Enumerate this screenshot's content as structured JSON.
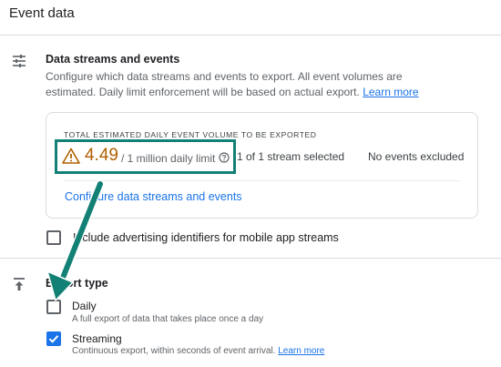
{
  "page": {
    "title": "Event data"
  },
  "data_streams": {
    "title": "Data streams and events",
    "description": "Configure which data streams and events to export. All event volumes are estimated. Daily limit enforcement will be based on actual export.",
    "learn_more": "Learn more",
    "card": {
      "label": "TOTAL ESTIMATED DAILY EVENT VOLUME TO BE EXPORTED",
      "volume_value": "4.49",
      "volume_limit": "/ 1 million daily limit",
      "streams": "1 of 1 stream selected",
      "events": "No events excluded",
      "configure_link": "Configure data streams and events"
    },
    "advertising_checkbox": {
      "label": "Include advertising identifiers for mobile app streams",
      "checked": false
    }
  },
  "export_type": {
    "title": "Export type",
    "options": [
      {
        "title": "Daily",
        "description": "A full export of data that takes place once a day",
        "checked": false
      },
      {
        "title": "Streaming",
        "description": "Continuous export, within seconds of event arrival.",
        "learn_more": "Learn more",
        "checked": true
      }
    ]
  },
  "colors": {
    "accent": "#1a73e8",
    "warning": "#b06000",
    "highlight_annotation": "#138075"
  },
  "icons": [
    "tune-icon",
    "warning-icon",
    "help-icon",
    "upload-icon",
    "check-icon"
  ]
}
